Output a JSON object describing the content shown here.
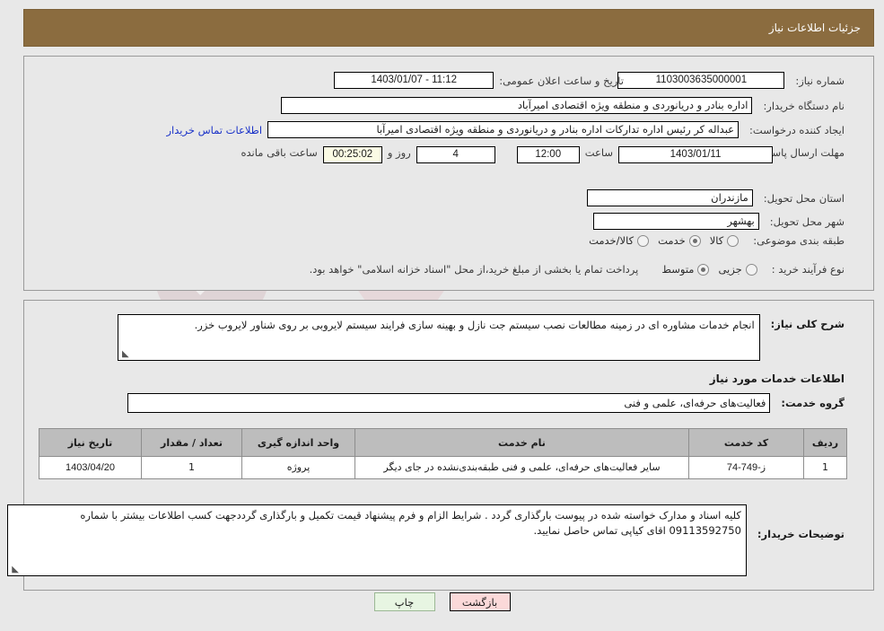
{
  "header": {
    "title": "جزئیات اطلاعات نیاز"
  },
  "fields": {
    "need_number_label": "شماره نیاز:",
    "need_number_value": "1103003635000001",
    "announce_label": "تاریخ و ساعت اعلان عمومی:",
    "announce_value": "1403/01/07 - 11:12",
    "buyer_org_label": "نام دستگاه خریدار:",
    "buyer_org_value": "اداره بنادر و دریانوردی و منطقه ویژه اقتصادی امیرآباد",
    "creator_label": "ایجاد کننده درخواست:",
    "creator_value": "عبداله کر رئیس اداره تدارکات اداره بنادر و دریانوردی و منطقه ویژه اقتصادی امیرآبا",
    "contact_link": "اطلاعات تماس خریدار",
    "deadline_label": "مهلت ارسال پاسخ: تا تاریخ:",
    "deadline_date": "1403/01/11",
    "hour_label": "ساعت",
    "deadline_time": "12:00",
    "days_remaining": "4",
    "days_label": "روز و",
    "countdown": "00:25:02",
    "remaining_label": "ساعت باقی مانده",
    "province_label": "استان محل تحویل:",
    "province_value": "مازندران",
    "city_label": "شهر محل تحویل:",
    "city_value": "بهشهر",
    "category_label": "طبقه بندی موضوعی:",
    "process_label": "نوع فرآیند خرید :",
    "payment_note": "پرداخت تمام یا بخشی از مبلغ خرید،از محل \"اسناد خزانه اسلامی\" خواهد بود."
  },
  "category_options": [
    {
      "label": "کالا",
      "selected": false
    },
    {
      "label": "خدمت",
      "selected": true
    },
    {
      "label": "کالا/خدمت",
      "selected": false
    }
  ],
  "process_options": [
    {
      "label": "جزیی",
      "selected": false
    },
    {
      "label": "متوسط",
      "selected": true
    }
  ],
  "description": {
    "label": "شرح کلی نیاز:",
    "value": "انجام خدمات مشاوره ای در زمینه مطالعات نصب سیستم جت نازل و بهینه سازی فرایند سیستم لایروبی بر روی شناور لایروب خزر."
  },
  "services_section": {
    "title": "اطلاعات خدمات مورد نیاز",
    "group_label": "گروه خدمت:",
    "group_value": "فعالیت‌های حرفه‌ای، علمی و فنی"
  },
  "table": {
    "columns": [
      "ردیف",
      "کد خدمت",
      "نام خدمت",
      "واحد اندازه گیری",
      "تعداد / مقدار",
      "تاریخ نیاز"
    ],
    "rows": [
      {
        "index": "1",
        "code": "ز-749-74",
        "name": "سایر فعالیت‌های حرفه‌ای، علمی و فنی طبقه‌بندی‌نشده در جای دیگر",
        "unit": "پروژه",
        "quantity": "1",
        "date": "1403/04/20"
      }
    ]
  },
  "buyer_notes": {
    "label": "توضیحات خریدار:",
    "value": "کلیه اسناد و مدارک خواسته شده در پیوست بارگذاری گردد . شرایط الزام و فرم پیشنهاد قیمت تکمیل و بارگذاری گرددجهت کسب اطلاعات بیشتر با شماره 09113592750 اقای کیاپی تماس حاصل نمایید."
  },
  "buttons": {
    "print": "چاپ",
    "back": "بازگشت"
  },
  "watermark": {
    "text": "AriaTender.net"
  },
  "colors": {
    "header_bg": "#8b6c3f",
    "page_bg": "#e8e8e8",
    "link": "#1a32c8",
    "table_header_bg": "#bdbdbd",
    "countdown_bg": "#fbfbe4",
    "print_btn_bg": "#e7f5e2",
    "back_btn_bg": "#fbd9d9"
  }
}
